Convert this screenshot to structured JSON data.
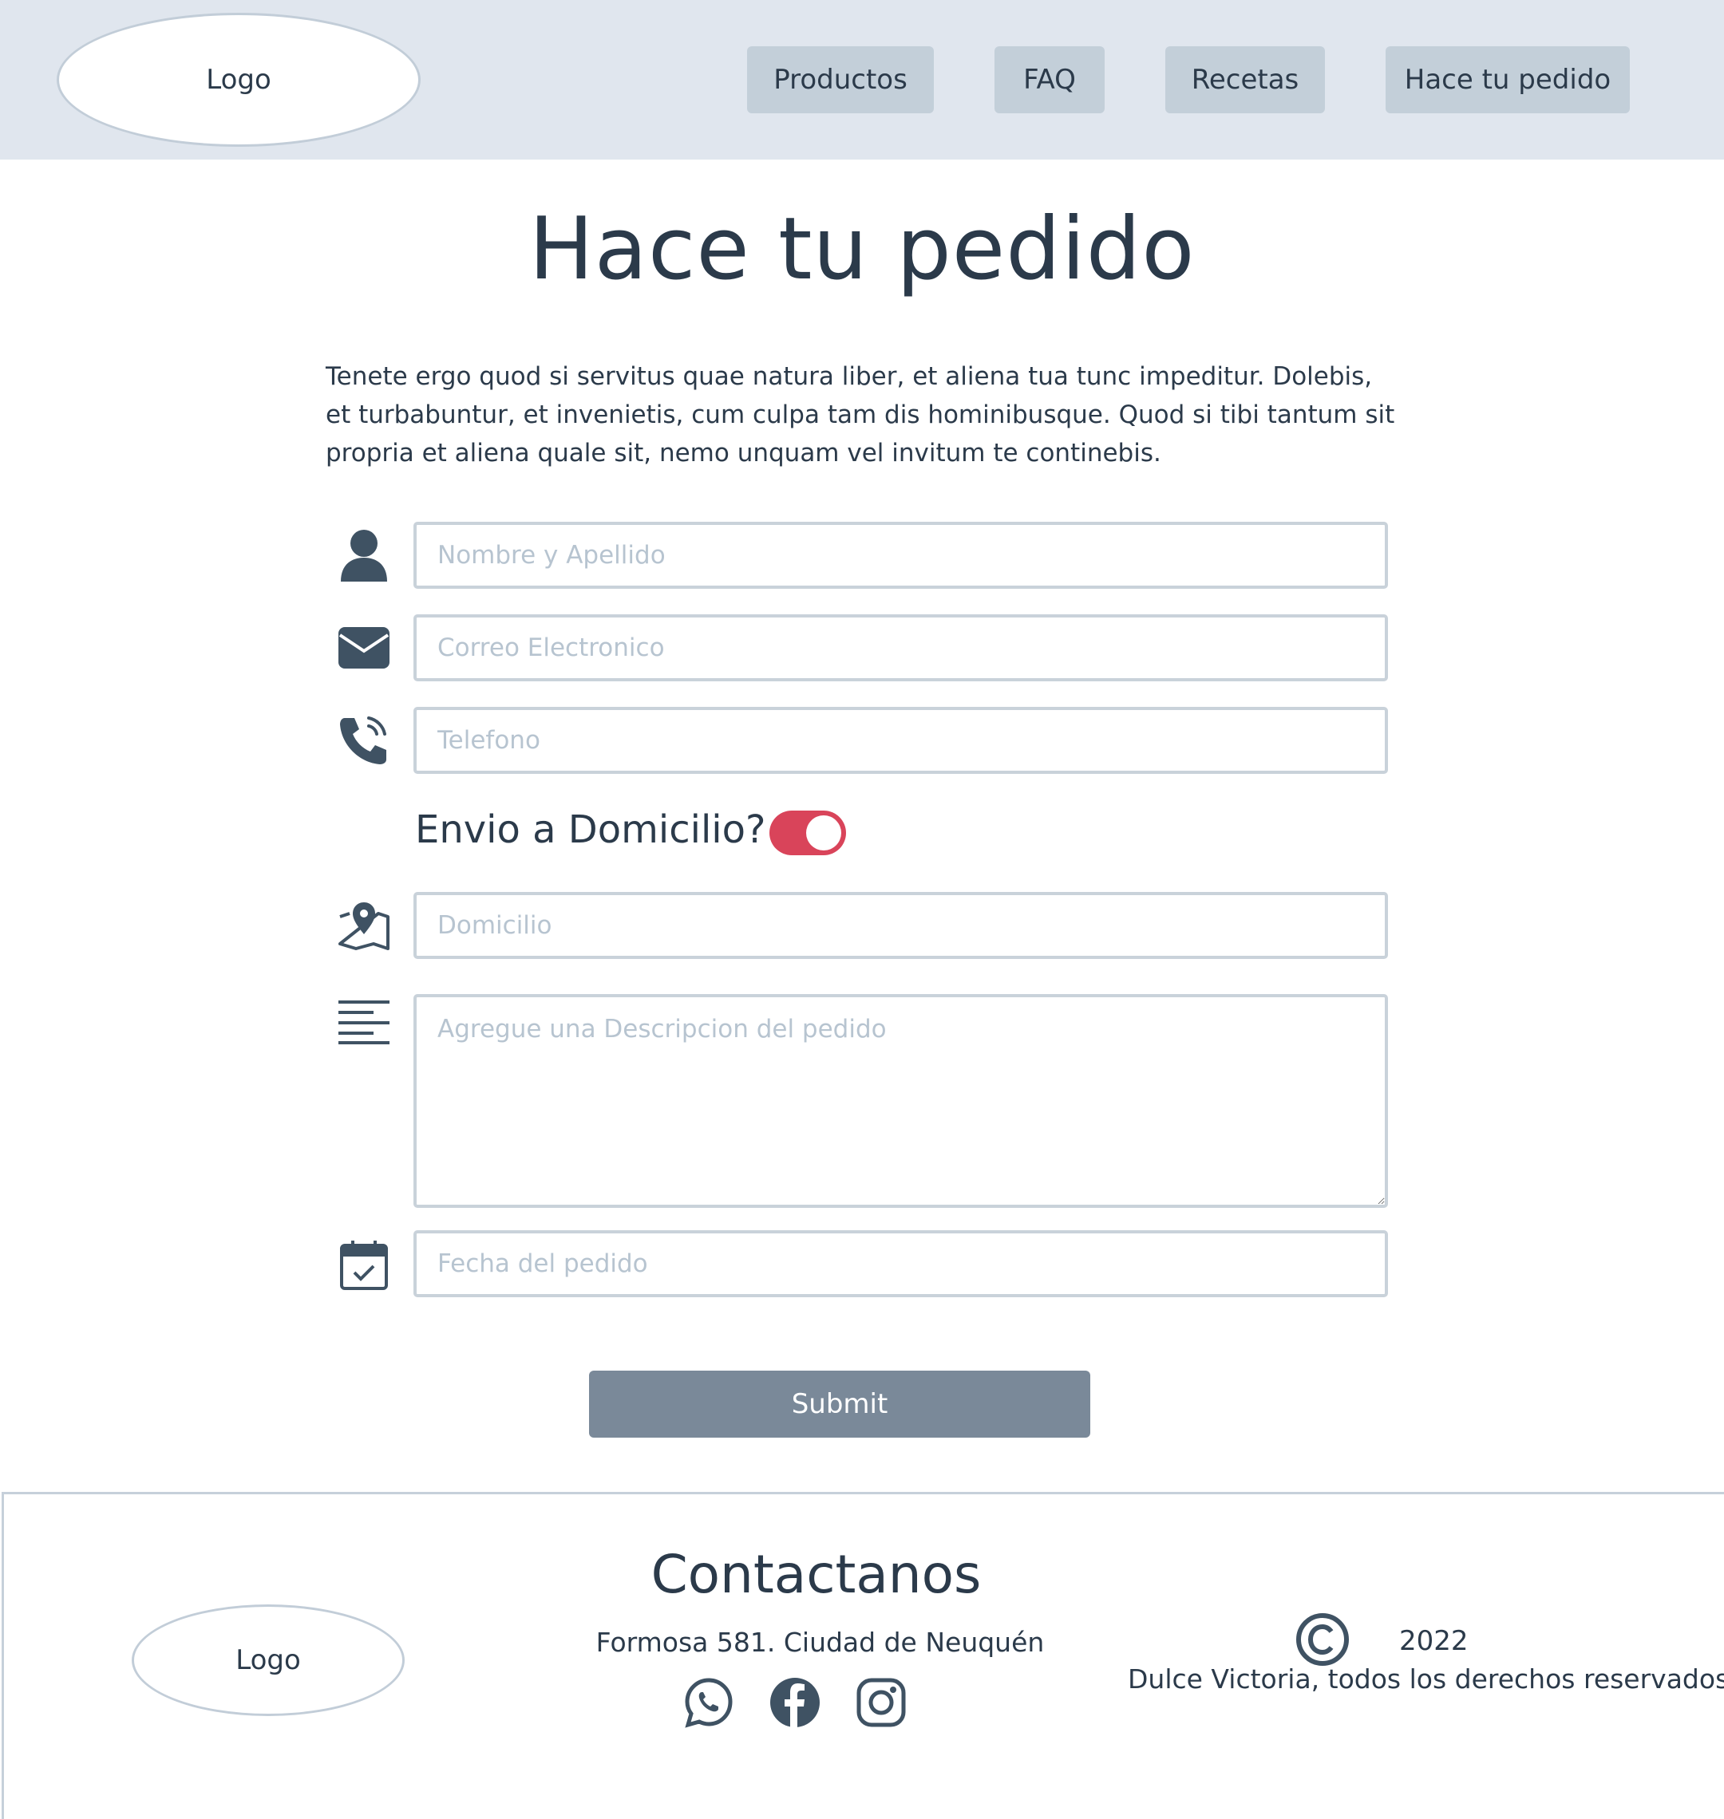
{
  "header": {
    "logo": "Logo",
    "nav": [
      {
        "label": "Productos"
      },
      {
        "label": "FAQ"
      },
      {
        "label": "Recetas"
      },
      {
        "label": "Hace tu pedido"
      }
    ]
  },
  "main": {
    "title": "Hace tu pedido",
    "intro": "Tenete ergo quod si servitus quae natura liber, et aliena tua tunc impeditur. Dolebis, et turbabuntur, et invenietis, cum culpa tam dis hominibusque. Quod si tibi tantum sit propria et aliena quale sit, nemo unquam vel invitum te continebis."
  },
  "form": {
    "name": {
      "placeholder": "Nombre y Apellido",
      "value": "",
      "icon": "user-icon"
    },
    "email": {
      "placeholder": "Correo Electronico",
      "value": "",
      "icon": "envelope-icon"
    },
    "phone": {
      "placeholder": "Telefono",
      "value": "",
      "icon": "phone-icon"
    },
    "delivery_toggle": {
      "label": "Envio a Domicilio?",
      "on": true
    },
    "address": {
      "placeholder": "Domicilio",
      "value": "",
      "icon": "map-pin-icon"
    },
    "description": {
      "placeholder": "Agregue una Descripcion del pedido",
      "value": "",
      "icon": "align-left-icon"
    },
    "date": {
      "placeholder": "Fecha del pedido",
      "value": "",
      "icon": "calendar-check-icon"
    },
    "submit_label": "Submit"
  },
  "footer": {
    "logo": "Logo",
    "contact_title": "Contactanos",
    "address": "Formosa 581. Ciudad de Neuquén",
    "social": [
      "whatsapp-icon",
      "facebook-icon",
      "instagram-icon"
    ],
    "year": "2022",
    "rights": "Dulce Victoria, todos los derechos reservados"
  },
  "colors": {
    "header_bg": "#e0e6ee",
    "nav_button": "#c3cfd9",
    "text": "#2b3a4a",
    "toggle_on": "#d9445a",
    "submit_bg": "#7a8999",
    "field_border": "#c9d2da"
  }
}
